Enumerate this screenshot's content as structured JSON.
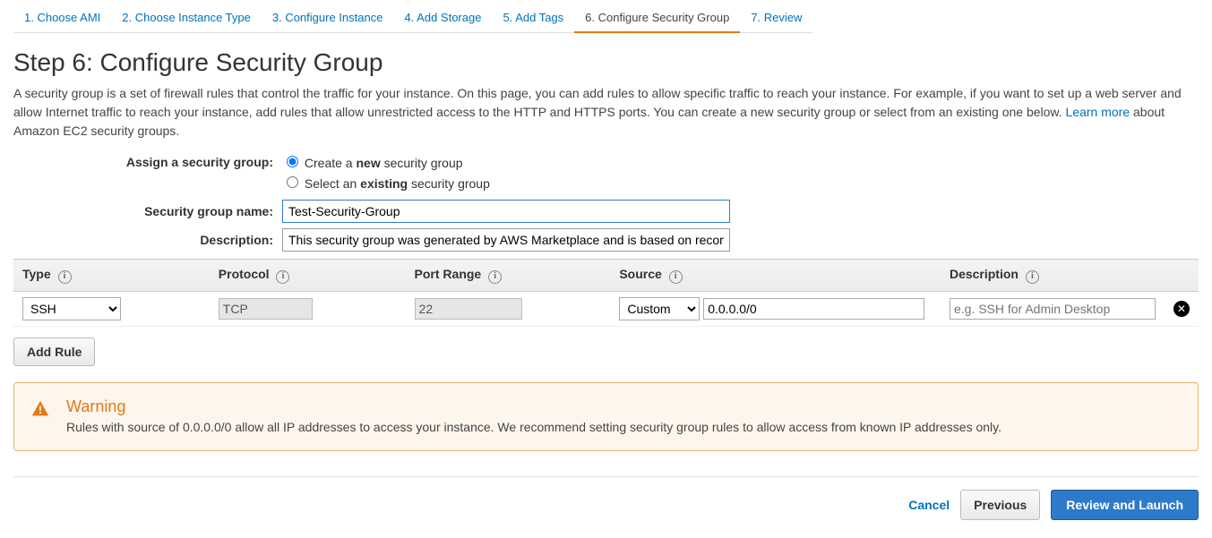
{
  "wizard_tabs": [
    {
      "label": "1. Choose AMI",
      "active": false
    },
    {
      "label": "2. Choose Instance Type",
      "active": false
    },
    {
      "label": "3. Configure Instance",
      "active": false
    },
    {
      "label": "4. Add Storage",
      "active": false
    },
    {
      "label": "5. Add Tags",
      "active": false
    },
    {
      "label": "6. Configure Security Group",
      "active": true
    },
    {
      "label": "7. Review",
      "active": false
    }
  ],
  "page_title": "Step 6: Configure Security Group",
  "intro_text_1": "A security group is a set of firewall rules that control the traffic for your instance. On this page, you can add rules to allow specific traffic to reach your instance. For example, if you want to set up a web server and allow Internet traffic to reach your instance, add rules that allow unrestricted access to the HTTP and HTTPS ports. You can create a new security group or select from an existing one below. ",
  "learn_more_label": "Learn more",
  "intro_text_2": " about Amazon EC2 security groups.",
  "assign_label": "Assign a security group:",
  "radio_create_pre": "Create a ",
  "radio_create_bold": "new",
  "radio_create_post": " security group",
  "radio_select_pre": "Select an ",
  "radio_select_bold": "existing",
  "radio_select_post": " security group",
  "sg_name_label": "Security group name:",
  "sg_name_value": "Test-Security-Group",
  "sg_desc_label": "Description:",
  "sg_desc_value": "This security group was generated by AWS Marketplace and is based on recomm",
  "columns": {
    "type": "Type",
    "protocol": "Protocol",
    "port": "Port Range",
    "source": "Source",
    "description": "Description"
  },
  "rule": {
    "type_selected": "SSH",
    "protocol": "TCP",
    "port": "22",
    "source_mode": "Custom",
    "cidr": "0.0.0.0/0",
    "desc_placeholder": "e.g. SSH for Admin Desktop"
  },
  "add_rule_label": "Add Rule",
  "warning": {
    "title": "Warning",
    "text": "Rules with source of 0.0.0.0/0 allow all IP addresses to access your instance. We recommend setting security group rules to allow access from known IP addresses only."
  },
  "footer": {
    "cancel": "Cancel",
    "previous": "Previous",
    "review_launch": "Review and Launch"
  }
}
